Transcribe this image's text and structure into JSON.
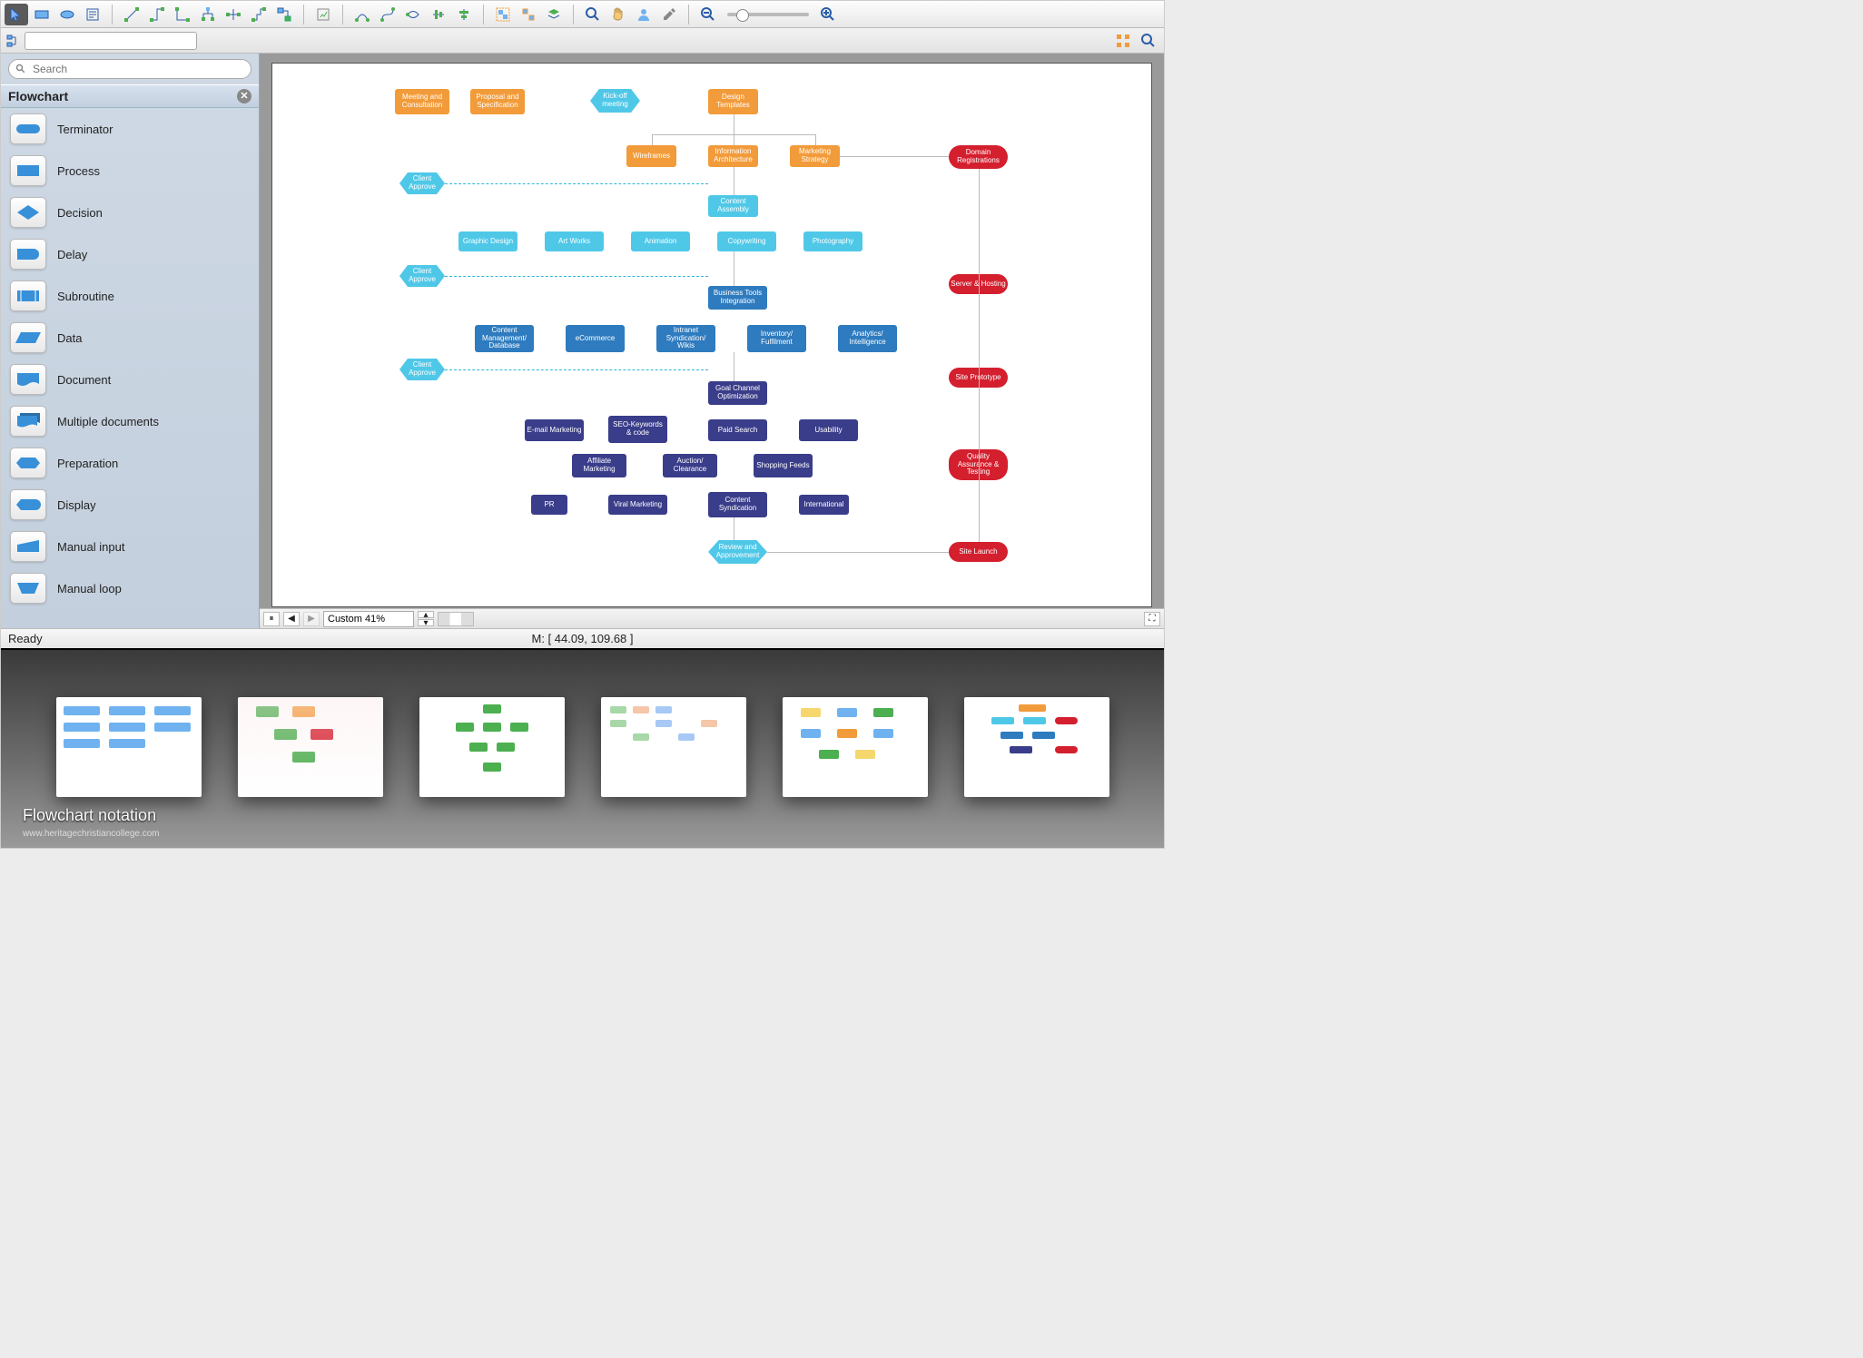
{
  "toolbar_icons": [
    "pointer",
    "rect",
    "ellipse",
    "text",
    "conn-straight",
    "conn-step",
    "conn-orth",
    "conn-tree",
    "conn-smart",
    "conn-route",
    "conn-auto",
    "insert",
    "curve1",
    "curve2",
    "curve-smart",
    "align-h",
    "align-v",
    "distribute",
    "group",
    "ungroup",
    "layers",
    "zoom-in",
    "pan",
    "user",
    "eyedrop",
    "zoom-out-slider",
    "zoom-in-slider"
  ],
  "sidebar": {
    "search_placeholder": "Search",
    "library_title": "Flowchart",
    "shapes": [
      {
        "name": "Terminator"
      },
      {
        "name": "Process"
      },
      {
        "name": "Decision"
      },
      {
        "name": "Delay"
      },
      {
        "name": "Subroutine"
      },
      {
        "name": "Data"
      },
      {
        "name": "Document"
      },
      {
        "name": "Multiple documents"
      },
      {
        "name": "Preparation"
      },
      {
        "name": "Display"
      },
      {
        "name": "Manual input"
      },
      {
        "name": "Manual loop"
      }
    ]
  },
  "canvas": {
    "zoom_text": "Custom 41%",
    "nodes": {
      "r1a": "Meeting and Consultation",
      "r1b": "Proposal and Specification",
      "r1c": "Kick-off meeting",
      "r1d": "Design Templates",
      "r2a": "Wireframes",
      "r2b": "Information Architecture",
      "r2c": "Marketing Strategy",
      "ca1": "Client Approve",
      "ca2": "Client Approve",
      "ca3": "Client Approve",
      "r3": "Content Assembly",
      "r4a": "Graphic Design",
      "r4b": "Art Works",
      "r4c": "Animation",
      "r4d": "Copywriting",
      "r4e": "Photography",
      "r5": "Business Tools Integration",
      "r6a": "Content Management/ Database",
      "r6b": "eCommerce",
      "r6c": "Intranet Syndication/ Wikis",
      "r6d": "Inventory/ Fulfilment",
      "r6e": "Analytics/ Intelligence",
      "r7": "Goal Channel Optimization",
      "r8a": "E-mail Marketing",
      "r8b": "SEO-Keywords & code",
      "r8c": "Paid Search",
      "r8d": "Usability",
      "r9a": "Affiliate Marketing",
      "r9b": "Auction/ Clearance",
      "r9c": "Shopping Feeds",
      "r10a": "PR",
      "r10b": "Viral Marketing",
      "r10c": "Content Syndication",
      "r10d": "International",
      "r11": "Review and Approvement",
      "red1": "Domain Registrations",
      "red2": "Server & Hosting",
      "red3": "Site Prototype",
      "red4": "Quality Assurance & Testing",
      "red5": "Site Launch"
    }
  },
  "status": {
    "ready": "Ready",
    "coords": "M: [ 44.09, 109.68 ]"
  },
  "gallery": {
    "title": "Flowchart notation",
    "sub": "www.heritagechristiancollege.com"
  }
}
